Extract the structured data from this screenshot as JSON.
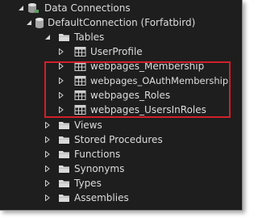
{
  "tree": {
    "data_connections": {
      "label": "Data Connections",
      "icon": "database-connection-icon"
    },
    "connection": {
      "label": "DefaultConnection (Forfatbird)",
      "icon": "database-cylinder-icon"
    },
    "tables_folder": {
      "label": "Tables",
      "icon": "folder-icon"
    },
    "tables": [
      {
        "label": "UserProfile",
        "icon": "table-grid-icon",
        "highlighted": false
      },
      {
        "label": "webpages_Membership",
        "icon": "table-grid-icon",
        "highlighted": true
      },
      {
        "label": "webpages_OAuthMembership",
        "icon": "table-grid-icon",
        "highlighted": true
      },
      {
        "label": "webpages_Roles",
        "icon": "table-grid-icon",
        "highlighted": true
      },
      {
        "label": "webpages_UsersInRoles",
        "icon": "table-grid-icon",
        "highlighted": true
      }
    ],
    "folders": [
      {
        "label": "Views",
        "icon": "folder-icon"
      },
      {
        "label": "Stored Procedures",
        "icon": "folder-icon"
      },
      {
        "label": "Functions",
        "icon": "folder-icon"
      },
      {
        "label": "Synonyms",
        "icon": "folder-icon"
      },
      {
        "label": "Types",
        "icon": "folder-icon"
      },
      {
        "label": "Assemblies",
        "icon": "folder-icon"
      }
    ]
  },
  "colors": {
    "background": "#1e1e1e",
    "text": "#dcdcdc",
    "highlight_border": "#d0212a",
    "folder": "#d9d9d9"
  }
}
